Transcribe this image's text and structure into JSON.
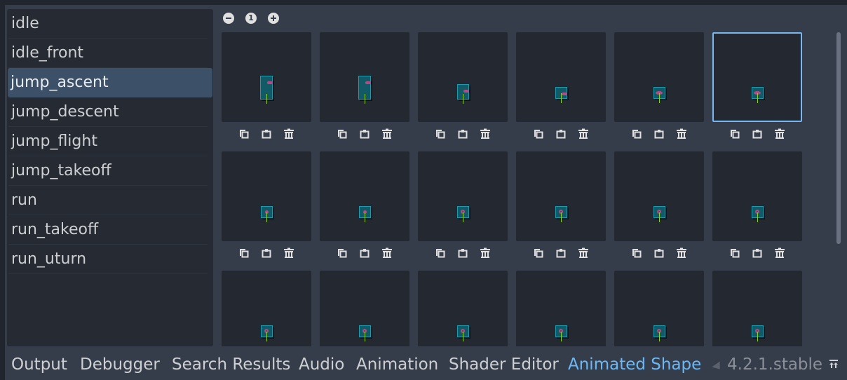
{
  "animations": [
    {
      "name": "idle",
      "selected": false
    },
    {
      "name": "idle_front",
      "selected": false
    },
    {
      "name": "jump_ascent",
      "selected": true
    },
    {
      "name": "jump_descent",
      "selected": false
    },
    {
      "name": "jump_flight",
      "selected": false
    },
    {
      "name": "jump_takeoff",
      "selected": false
    },
    {
      "name": "run",
      "selected": false
    },
    {
      "name": "run_takeoff",
      "selected": false
    },
    {
      "name": "run_uturn",
      "selected": false
    }
  ],
  "zoom_controls": {
    "zoom_out": "−",
    "zoom_reset": "1",
    "zoom_in": "+"
  },
  "frame_tools": [
    "copy-icon",
    "paste-icon",
    "delete-icon"
  ],
  "frames": [
    {
      "index": 0,
      "sprite": "tall",
      "selected": false
    },
    {
      "index": 1,
      "sprite": "tall",
      "selected": false
    },
    {
      "index": 2,
      "sprite": "medium",
      "selected": false
    },
    {
      "index": 3,
      "sprite": "small-flat",
      "selected": false
    },
    {
      "index": 4,
      "sprite": "square-oval",
      "selected": false
    },
    {
      "index": 5,
      "sprite": "square-oval",
      "selected": true
    },
    {
      "index": 6,
      "sprite": "square-dot",
      "selected": false
    },
    {
      "index": 7,
      "sprite": "square-dot",
      "selected": false
    },
    {
      "index": 8,
      "sprite": "square-spin",
      "selected": false
    },
    {
      "index": 9,
      "sprite": "square-spin",
      "selected": false
    },
    {
      "index": 10,
      "sprite": "square-spin",
      "selected": false
    },
    {
      "index": 11,
      "sprite": "square-spin",
      "selected": false
    },
    {
      "index": 12,
      "sprite": "square-spin",
      "selected": false
    },
    {
      "index": 13,
      "sprite": "square-spin",
      "selected": false
    },
    {
      "index": 14,
      "sprite": "square-spin",
      "selected": false
    },
    {
      "index": 15,
      "sprite": "square-spin",
      "selected": false
    },
    {
      "index": 16,
      "sprite": "square-spin",
      "selected": false
    },
    {
      "index": 17,
      "sprite": "square-spin",
      "selected": false
    }
  ],
  "bottom_tabs": [
    {
      "label": "Output",
      "active": false
    },
    {
      "label": "Debugger",
      "active": false
    },
    {
      "label": "Search Results",
      "active": false
    },
    {
      "label": "Audio",
      "active": false
    },
    {
      "label": "Animation",
      "active": false
    },
    {
      "label": "Shader Editor",
      "active": false
    },
    {
      "label": "Animated Shape",
      "active": true
    }
  ],
  "version": "4.2.1.stable",
  "colors": {
    "accent": "#6cb8f5",
    "selection_bg": "#3c5068",
    "frame_selected_border": "#78b7f0",
    "panel_bg": "#363d4a",
    "frame_bg": "#232831"
  }
}
